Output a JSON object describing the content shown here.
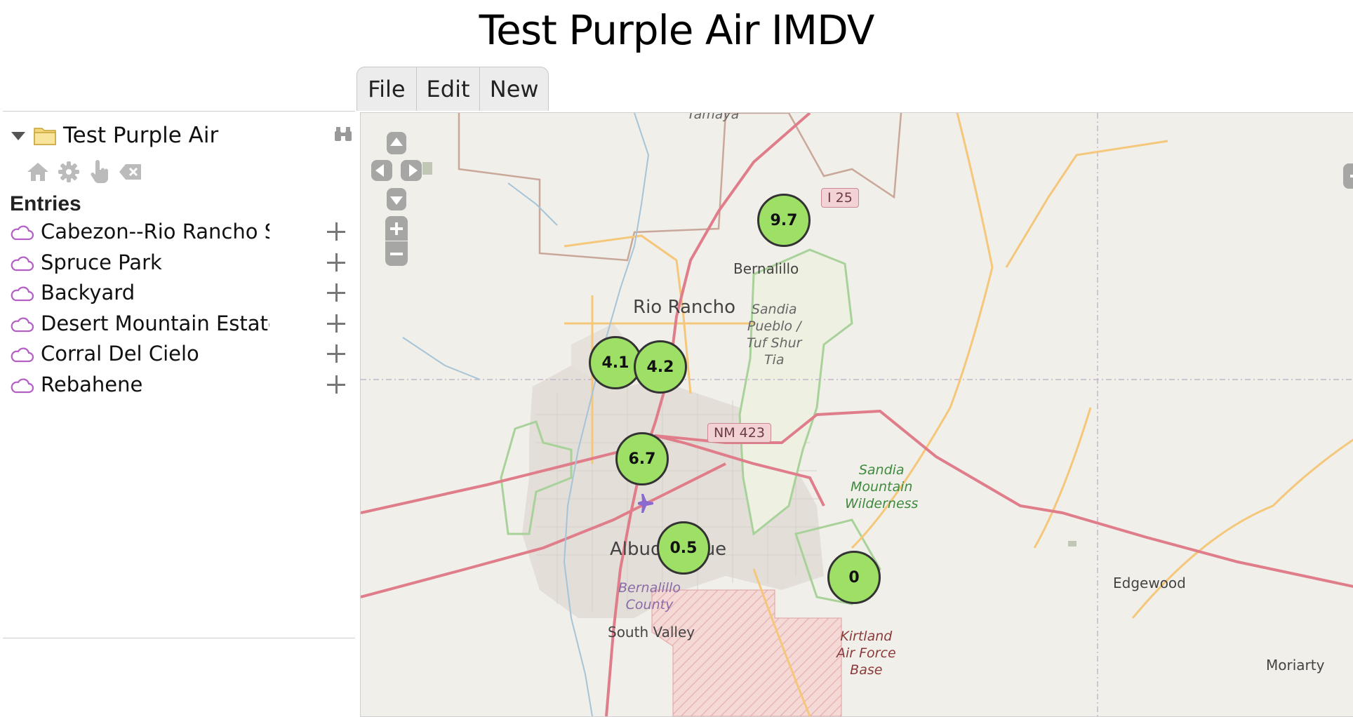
{
  "page": {
    "title": "Test Purple Air IMDV"
  },
  "menu": {
    "items": [
      "File",
      "Edit",
      "New"
    ]
  },
  "sidebar": {
    "tree_title": "Test Purple Air",
    "entries_heading": "Entries",
    "toolbar_icons": [
      "home-icon",
      "gear-icon",
      "pointer-hand-icon",
      "clear-icon"
    ],
    "entries": [
      {
        "label": "Cabezon--Rio Rancho South"
      },
      {
        "label": "Spruce Park"
      },
      {
        "label": "Backyard"
      },
      {
        "label": "Desert Mountain Estates"
      },
      {
        "label": "Corral Del Cielo"
      },
      {
        "label": "Rebahene"
      }
    ]
  },
  "map": {
    "place_labels": {
      "tamaya": "Tamaya",
      "bernalillo": "Bernalillo",
      "rio_rancho": "Rio Rancho",
      "sandia_pueblo": "Sandia\nPueblo /\nTuf Shur\nTia",
      "sandia_wilderness": "Sandia\nMountain\nWilderness",
      "albuquerque": "Albuquerque",
      "bernalillo_county": "Bernalillo\nCounty",
      "south_valley": "South Valley",
      "kirtland": "Kirtland\nAir Force\nBase",
      "edgewood": "Edgewood",
      "moriarty": "Moriarty"
    },
    "shields": {
      "i25": "I 25",
      "nm423": "NM 423"
    },
    "markers": [
      "9.7",
      "4.1",
      "4.2",
      "6.7",
      "0.5",
      "0"
    ],
    "colors": {
      "marker_fill": "#9ee066",
      "road_primary": "#e07d8a",
      "road_secondary": "#f5c77a",
      "protected_area": "#9ccc8a"
    }
  }
}
